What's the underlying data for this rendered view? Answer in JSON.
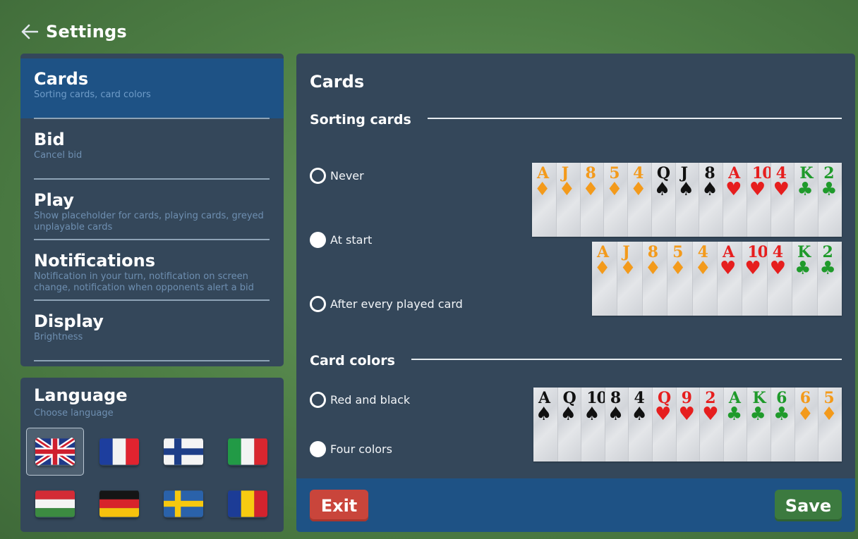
{
  "header": {
    "title": "Settings",
    "back_icon": "arrow-left-icon"
  },
  "menu": {
    "items": [
      {
        "title": "Cards",
        "subtitle": "Sorting cards, card colors",
        "active": true
      },
      {
        "title": "Bid",
        "subtitle": "Cancel bid",
        "active": false
      },
      {
        "title": "Play",
        "subtitle": "Show placeholder for cards, playing cards, greyed unplayable cards",
        "active": false
      },
      {
        "title": "Notifications",
        "subtitle": "Notification in your turn, notification on screen change, notification when opponents alert a bid",
        "active": false
      },
      {
        "title": "Display",
        "subtitle": "Brightness",
        "active": false
      }
    ]
  },
  "language": {
    "title": "Language",
    "subtitle": "Choose language",
    "flags": [
      "uk-flag",
      "france-flag",
      "finland-flag",
      "italy-flag",
      "hungary-flag",
      "germany-flag",
      "sweden-flag",
      "romania-flag"
    ],
    "selected": "uk-flag"
  },
  "content": {
    "title": "Cards",
    "sorting": {
      "title": "Sorting cards",
      "options": [
        {
          "label": "Never",
          "checked": false
        },
        {
          "label": "At start",
          "checked": true
        },
        {
          "label": "After every played card",
          "checked": false
        }
      ],
      "preview_unsorted": [
        {
          "rank": "A",
          "suit": "diamond",
          "color": "#f39a1b"
        },
        {
          "rank": "J",
          "suit": "diamond",
          "color": "#f39a1b"
        },
        {
          "rank": "8",
          "suit": "diamond",
          "color": "#f39a1b"
        },
        {
          "rank": "5",
          "suit": "diamond",
          "color": "#f39a1b"
        },
        {
          "rank": "4",
          "suit": "diamond",
          "color": "#f39a1b"
        },
        {
          "rank": "Q",
          "suit": "spade",
          "color": "#111111"
        },
        {
          "rank": "J",
          "suit": "spade",
          "color": "#111111"
        },
        {
          "rank": "8",
          "suit": "spade",
          "color": "#111111"
        },
        {
          "rank": "A",
          "suit": "heart",
          "color": "#e61e1e"
        },
        {
          "rank": "10",
          "suit": "heart",
          "color": "#e61e1e"
        },
        {
          "rank": "4",
          "suit": "heart",
          "color": "#e61e1e"
        },
        {
          "rank": "K",
          "suit": "club",
          "color": "#1f9a2b"
        },
        {
          "rank": "2",
          "suit": "club",
          "color": "#1f9a2b"
        }
      ],
      "preview_sorted": [
        {
          "rank": "A",
          "suit": "diamond",
          "color": "#f39a1b"
        },
        {
          "rank": "J",
          "suit": "diamond",
          "color": "#f39a1b"
        },
        {
          "rank": "8",
          "suit": "diamond",
          "color": "#f39a1b"
        },
        {
          "rank": "5",
          "suit": "diamond",
          "color": "#f39a1b"
        },
        {
          "rank": "4",
          "suit": "diamond",
          "color": "#f39a1b"
        },
        {
          "rank": "A",
          "suit": "heart",
          "color": "#e61e1e"
        },
        {
          "rank": "10",
          "suit": "heart",
          "color": "#e61e1e"
        },
        {
          "rank": "4",
          "suit": "heart",
          "color": "#e61e1e"
        },
        {
          "rank": "K",
          "suit": "club",
          "color": "#1f9a2b"
        },
        {
          "rank": "2",
          "suit": "club",
          "color": "#1f9a2b"
        }
      ]
    },
    "colors": {
      "title": "Card colors",
      "options": [
        {
          "label": "Red and black",
          "checked": false
        },
        {
          "label": "Four colors",
          "checked": true
        }
      ],
      "preview": [
        {
          "rank": "A",
          "suit": "spade",
          "color": "#111111"
        },
        {
          "rank": "Q",
          "suit": "spade",
          "color": "#111111"
        },
        {
          "rank": "10",
          "suit": "spade",
          "color": "#111111"
        },
        {
          "rank": "8",
          "suit": "spade",
          "color": "#111111"
        },
        {
          "rank": "4",
          "suit": "spade",
          "color": "#111111"
        },
        {
          "rank": "Q",
          "suit": "heart",
          "color": "#e61e1e"
        },
        {
          "rank": "9",
          "suit": "heart",
          "color": "#e61e1e"
        },
        {
          "rank": "2",
          "suit": "heart",
          "color": "#e61e1e"
        },
        {
          "rank": "A",
          "suit": "club",
          "color": "#1f9a2b"
        },
        {
          "rank": "K",
          "suit": "club",
          "color": "#1f9a2b"
        },
        {
          "rank": "6",
          "suit": "club",
          "color": "#1f9a2b"
        },
        {
          "rank": "6",
          "suit": "diamond",
          "color": "#f39a1b"
        },
        {
          "rank": "5",
          "suit": "diamond",
          "color": "#f39a1b"
        }
      ]
    }
  },
  "footer": {
    "exit_label": "Exit",
    "save_label": "Save"
  },
  "colors": {
    "active_menu": "#1e5285",
    "panel": "#34475a",
    "exit": "#c9453b",
    "save": "#3c7a3f"
  }
}
